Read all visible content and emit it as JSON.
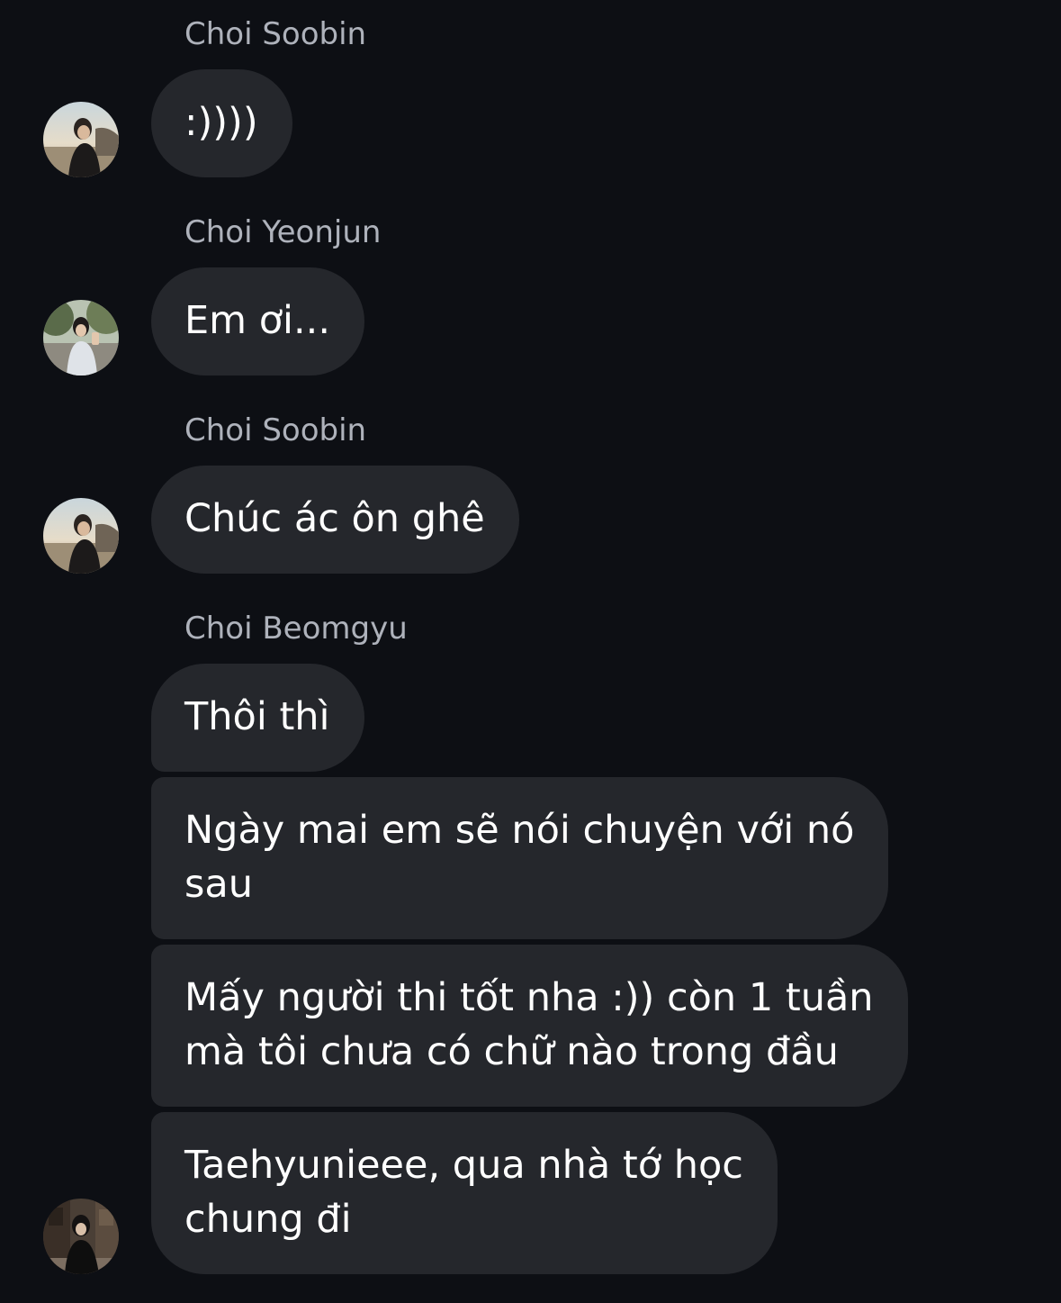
{
  "messages": [
    {
      "sender": "Choi Soobin",
      "text": ":))))"
    },
    {
      "sender": "Choi Yeonjun",
      "text": "Em ơi..."
    },
    {
      "sender": "Choi Soobin",
      "text": "Chúc ác ôn ghê"
    },
    {
      "sender": "Choi Beomgyu",
      "group": [
        {
          "lines": [
            "Thôi thì"
          ]
        },
        {
          "lines": [
            "Ngày mai em sẽ nói chuyện với nó",
            "sau"
          ]
        },
        {
          "lines": [
            "Mấy người thi tốt nha :)) còn 1 tuần",
            "mà tôi chưa có chữ nào trong đầu"
          ]
        },
        {
          "lines": [
            "Taehyunieee, qua nhà tớ học",
            "chung đi"
          ]
        }
      ]
    }
  ],
  "avatars": {
    "soobin": "avatar-beach-photo",
    "yeonjun": "avatar-park-photo",
    "beomgyu": "avatar-street-photo"
  },
  "colors": {
    "background": "#0d0f14",
    "bubble": "#25272c",
    "sender_name": "#aeb2bb",
    "text": "#ffffff"
  }
}
